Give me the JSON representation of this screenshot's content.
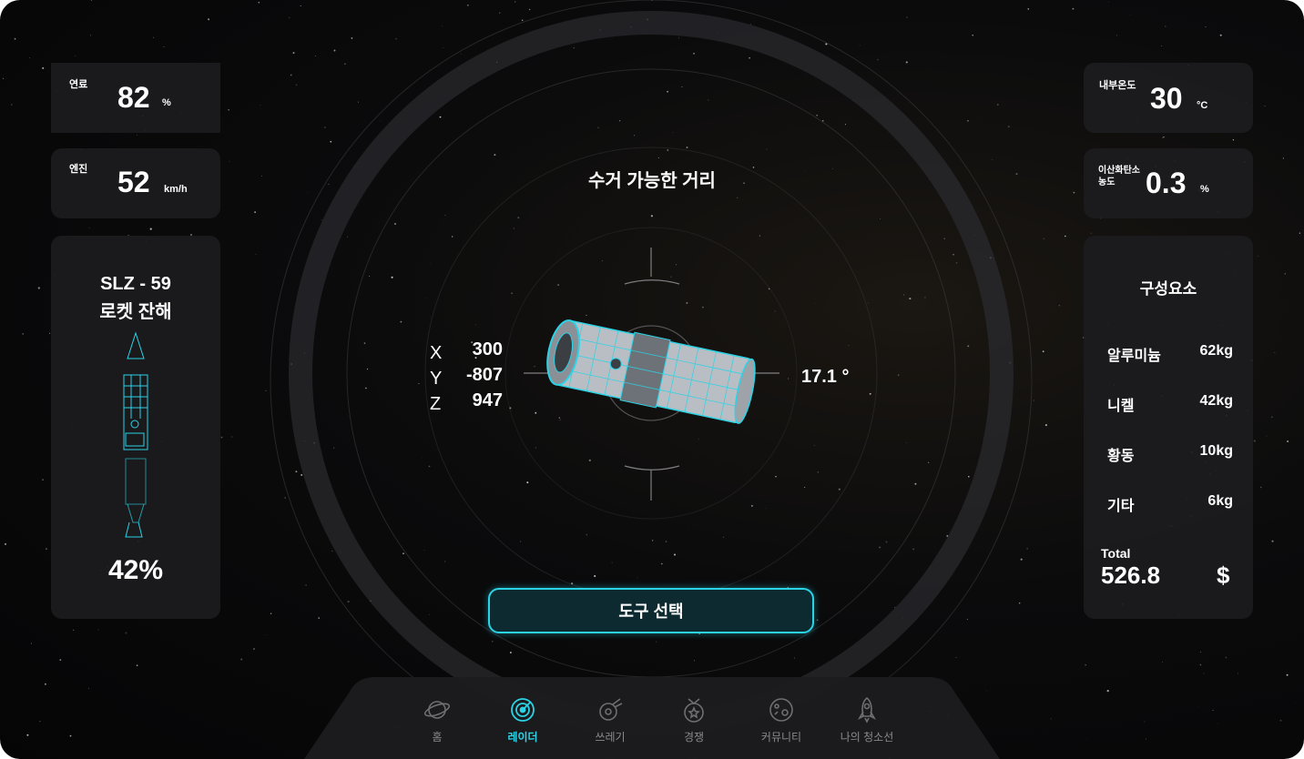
{
  "left_stats": [
    {
      "label": "연료",
      "value": "82",
      "unit": "%"
    },
    {
      "label": "엔진",
      "value": "52",
      "unit": "km/h"
    }
  ],
  "right_stats": [
    {
      "label": "내부온도",
      "value": "30",
      "unit": "°C"
    },
    {
      "label_line1": "이산화탄소",
      "label_line2": "농도",
      "value": "0.3",
      "unit": "%"
    }
  ],
  "debris": {
    "name_line1": "SLZ - 59",
    "name_line2": "로켓 잔해",
    "percent": "42%"
  },
  "center": {
    "title": "수거 가능한 거리",
    "coords": [
      {
        "axis": "X",
        "value": "300"
      },
      {
        "axis": "Y",
        "value": "-807"
      },
      {
        "axis": "Z",
        "value": "947"
      }
    ],
    "angle": "17.1 °",
    "tool_button": "도구 선택"
  },
  "components": {
    "title": "구성요소",
    "items": [
      {
        "name": "알루미늄",
        "weight": "62kg"
      },
      {
        "name": "니켈",
        "weight": "42kg"
      },
      {
        "name": "황동",
        "weight": "10kg"
      },
      {
        "name": "기타",
        "weight": "6kg"
      }
    ],
    "total_label": "Total",
    "total_value": "526.8",
    "currency": "$"
  },
  "nav": [
    {
      "label": "홈",
      "icon": "planet-icon",
      "active": false
    },
    {
      "label": "레이더",
      "icon": "radar-icon",
      "active": true
    },
    {
      "label": "쓰레기",
      "icon": "meteor-icon",
      "active": false
    },
    {
      "label": "경쟁",
      "icon": "medal-icon",
      "active": false
    },
    {
      "label": "커뮤니티",
      "icon": "globe-icon",
      "active": false
    },
    {
      "label": "나의 청소선",
      "icon": "rocket-icon",
      "active": false
    }
  ],
  "colors": {
    "accent": "#2ad3e6",
    "card": "#1c1c1e",
    "inactive": "#8a8a8e"
  }
}
